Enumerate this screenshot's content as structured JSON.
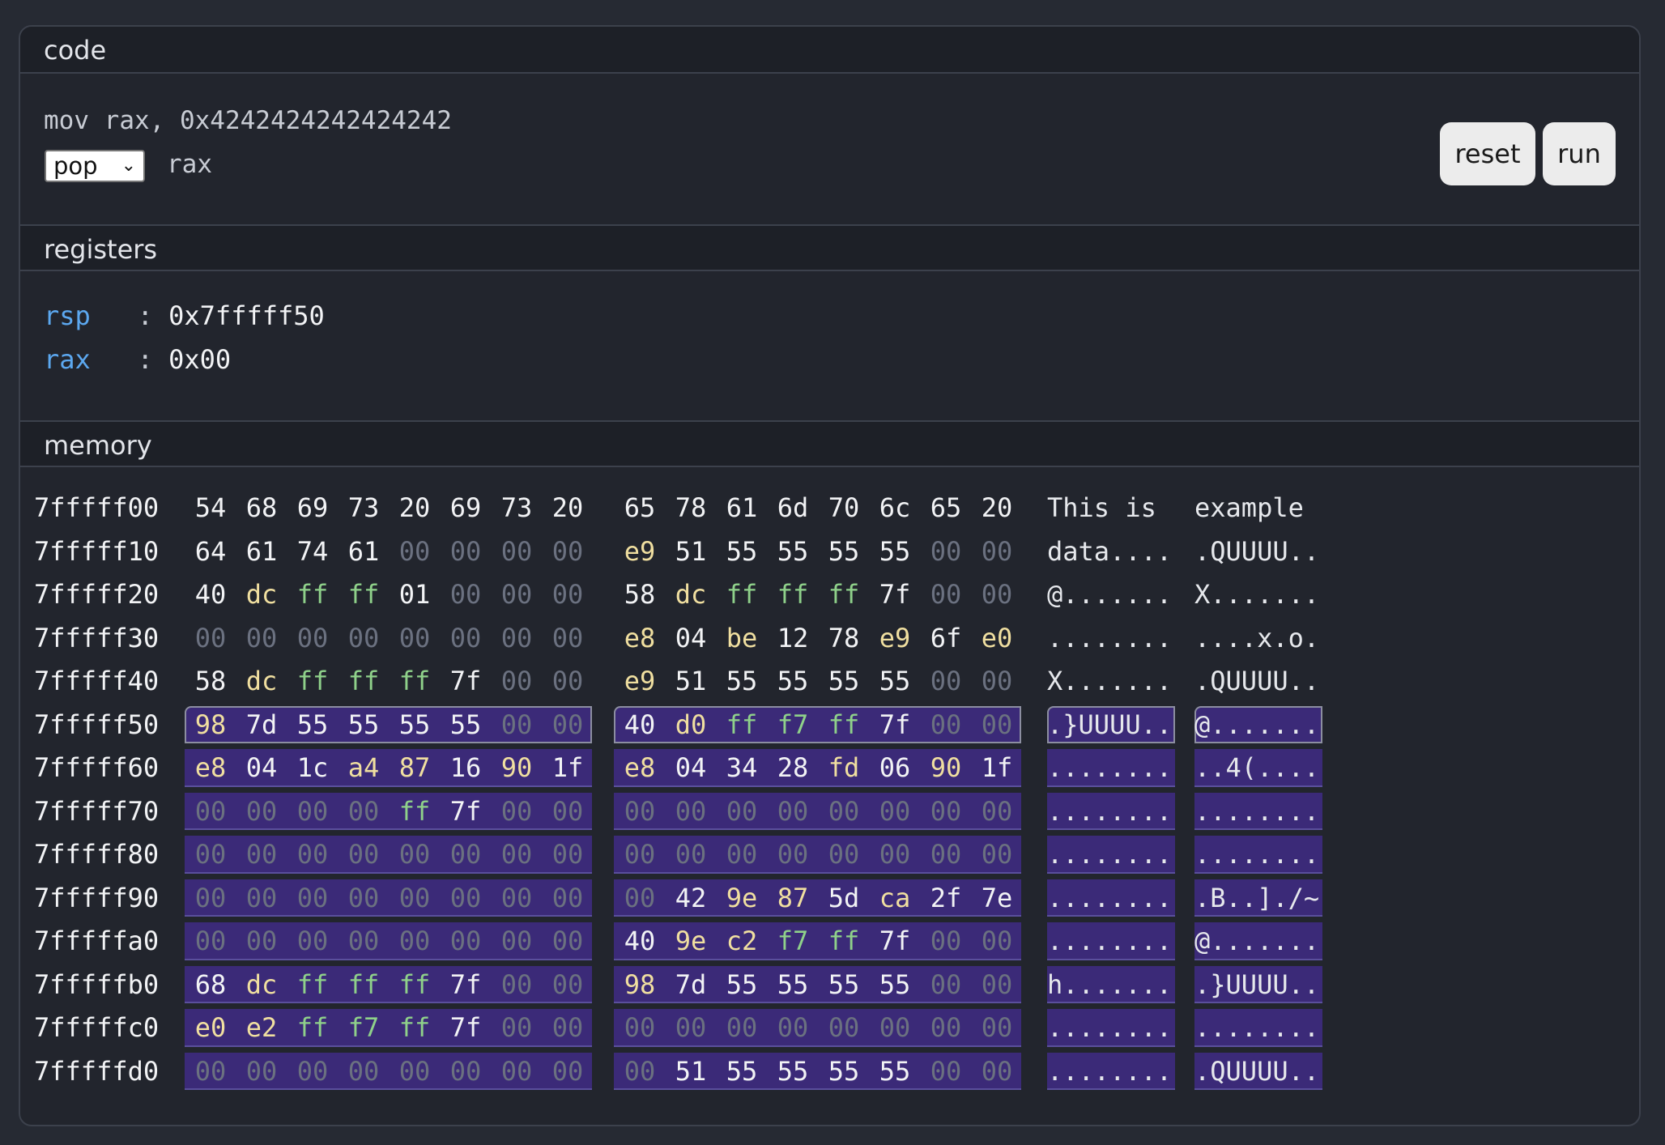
{
  "sections": {
    "code": "code",
    "registers": "registers",
    "memory": "memory"
  },
  "code": {
    "line1": "mov rax, 0x4242424242424242",
    "instruction_select": "pop",
    "line2_operand": "rax"
  },
  "buttons": {
    "reset": "reset",
    "run": "run"
  },
  "registers": [
    {
      "name": "rsp",
      "sep": ":",
      "value": "0x7fffff50"
    },
    {
      "name": "rax",
      "sep": ":",
      "value": "0x00"
    }
  ],
  "memory": {
    "highlight_start_row": 5,
    "rows": [
      {
        "addr": "7fffff00",
        "bytes": [
          "54",
          "68",
          "69",
          "73",
          "20",
          "69",
          "73",
          "20",
          "65",
          "78",
          "61",
          "6d",
          "70",
          "6c",
          "65",
          "20"
        ],
        "ascii1": "This is ",
        "ascii2": "example "
      },
      {
        "addr": "7fffff10",
        "bytes": [
          "64",
          "61",
          "74",
          "61",
          "00",
          "00",
          "00",
          "00",
          "e9",
          "51",
          "55",
          "55",
          "55",
          "55",
          "00",
          "00"
        ],
        "ascii1": "data....",
        "ascii2": ".QUUUU.."
      },
      {
        "addr": "7fffff20",
        "bytes": [
          "40",
          "dc",
          "ff",
          "ff",
          "01",
          "00",
          "00",
          "00",
          "58",
          "dc",
          "ff",
          "ff",
          "ff",
          "7f",
          "00",
          "00"
        ],
        "ascii1": "@.......",
        "ascii2": "X......."
      },
      {
        "addr": "7fffff30",
        "bytes": [
          "00",
          "00",
          "00",
          "00",
          "00",
          "00",
          "00",
          "00",
          "e8",
          "04",
          "be",
          "12",
          "78",
          "e9",
          "6f",
          "e0"
        ],
        "ascii1": "........",
        "ascii2": "....x.o."
      },
      {
        "addr": "7fffff40",
        "bytes": [
          "58",
          "dc",
          "ff",
          "ff",
          "ff",
          "7f",
          "00",
          "00",
          "e9",
          "51",
          "55",
          "55",
          "55",
          "55",
          "00",
          "00"
        ],
        "ascii1": "X.......",
        "ascii2": ".QUUUU.."
      },
      {
        "addr": "7fffff50",
        "bytes": [
          "98",
          "7d",
          "55",
          "55",
          "55",
          "55",
          "00",
          "00",
          "40",
          "d0",
          "ff",
          "f7",
          "ff",
          "7f",
          "00",
          "00"
        ],
        "ascii1": ".}UUUU..",
        "ascii2": "@......."
      },
      {
        "addr": "7fffff60",
        "bytes": [
          "e8",
          "04",
          "1c",
          "a4",
          "87",
          "16",
          "90",
          "1f",
          "e8",
          "04",
          "34",
          "28",
          "fd",
          "06",
          "90",
          "1f"
        ],
        "ascii1": "........",
        "ascii2": "..4(...."
      },
      {
        "addr": "7fffff70",
        "bytes": [
          "00",
          "00",
          "00",
          "00",
          "ff",
          "7f",
          "00",
          "00",
          "00",
          "00",
          "00",
          "00",
          "00",
          "00",
          "00",
          "00"
        ],
        "ascii1": "........",
        "ascii2": "........"
      },
      {
        "addr": "7fffff80",
        "bytes": [
          "00",
          "00",
          "00",
          "00",
          "00",
          "00",
          "00",
          "00",
          "00",
          "00",
          "00",
          "00",
          "00",
          "00",
          "00",
          "00"
        ],
        "ascii1": "........",
        "ascii2": "........"
      },
      {
        "addr": "7fffff90",
        "bytes": [
          "00",
          "00",
          "00",
          "00",
          "00",
          "00",
          "00",
          "00",
          "00",
          "42",
          "9e",
          "87",
          "5d",
          "ca",
          "2f",
          "7e"
        ],
        "ascii1": "........",
        "ascii2": ".B..]./~"
      },
      {
        "addr": "7fffffa0",
        "bytes": [
          "00",
          "00",
          "00",
          "00",
          "00",
          "00",
          "00",
          "00",
          "40",
          "9e",
          "c2",
          "f7",
          "ff",
          "7f",
          "00",
          "00"
        ],
        "ascii1": "........",
        "ascii2": "@......."
      },
      {
        "addr": "7fffffb0",
        "bytes": [
          "68",
          "dc",
          "ff",
          "ff",
          "ff",
          "7f",
          "00",
          "00",
          "98",
          "7d",
          "55",
          "55",
          "55",
          "55",
          "00",
          "00"
        ],
        "ascii1": "h.......",
        "ascii2": ".}UUUU.."
      },
      {
        "addr": "7fffffc0",
        "bytes": [
          "e0",
          "e2",
          "ff",
          "f7",
          "ff",
          "7f",
          "00",
          "00",
          "00",
          "00",
          "00",
          "00",
          "00",
          "00",
          "00",
          "00"
        ],
        "ascii1": "........",
        "ascii2": "........"
      },
      {
        "addr": "7fffffd0",
        "bytes": [
          "00",
          "00",
          "00",
          "00",
          "00",
          "00",
          "00",
          "00",
          "00",
          "51",
          "55",
          "55",
          "55",
          "55",
          "00",
          "00"
        ],
        "ascii1": "........",
        "ascii2": ".QUUUU.."
      }
    ]
  }
}
